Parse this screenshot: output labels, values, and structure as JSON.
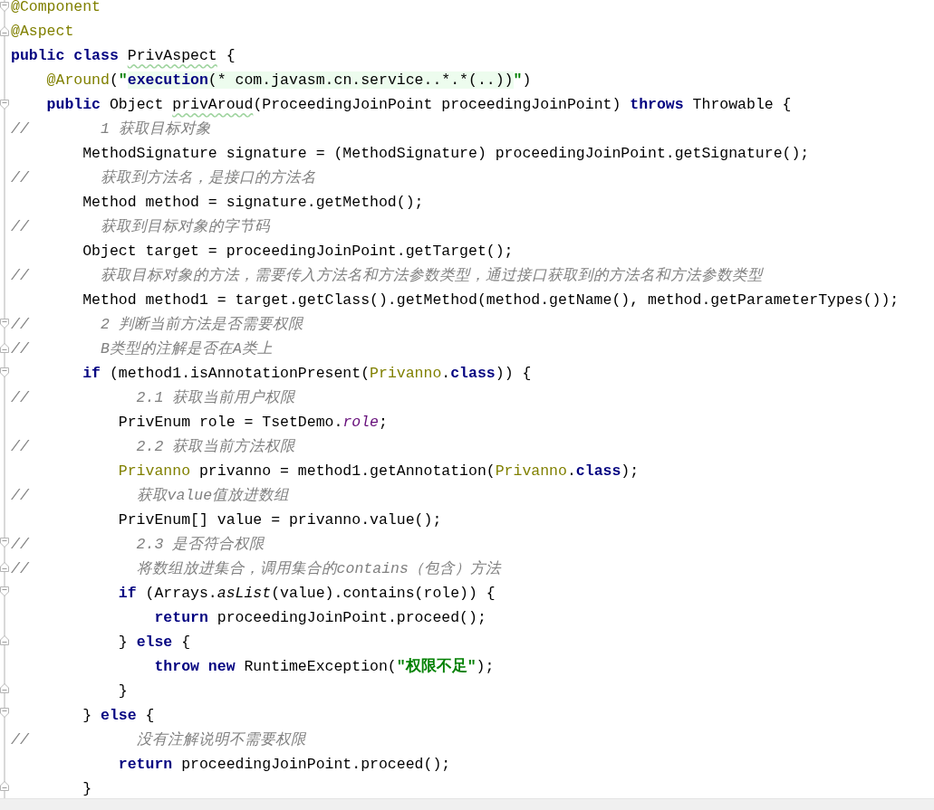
{
  "lines": [
    {
      "kind": "opener",
      "tokens": [
        {
          "kind": "ann",
          "text": "@Component"
        }
      ]
    },
    {
      "kind": "closer",
      "tokens": [
        {
          "kind": "ann",
          "text": "@Aspect"
        }
      ]
    },
    {
      "kind": "line",
      "tokens": [
        {
          "kind": "kw",
          "text": "public class "
        },
        {
          "kind": "warn",
          "text": "PrivAspect"
        },
        {
          "kind": "plain",
          "text": " {"
        }
      ]
    },
    {
      "kind": "line",
      "tokens": [
        {
          "kind": "ann",
          "text": "    @Around"
        },
        {
          "kind": "plain",
          "text": "("
        },
        {
          "kind": "str",
          "text": "\""
        },
        {
          "kind": "inj-kw",
          "text": "execution"
        },
        {
          "kind": "inj",
          "text": "(* com.javasm.cn.service..*.*(..))"
        },
        {
          "kind": "str",
          "text": "\""
        },
        {
          "kind": "plain",
          "text": ")"
        }
      ]
    },
    {
      "kind": "opener",
      "tokens": [
        {
          "kind": "kw",
          "text": "    public"
        },
        {
          "kind": "plain",
          "text": " Object "
        },
        {
          "kind": "warn",
          "text": "privAroud"
        },
        {
          "kind": "plain",
          "text": "(ProceedingJoinPoint proceedingJoinPoint) "
        },
        {
          "kind": "kw",
          "text": "throws"
        },
        {
          "kind": "plain",
          "text": " Throwable {"
        }
      ]
    },
    {
      "kind": "line",
      "tokens": [
        {
          "kind": "cmt",
          "text": "//        1 获取目标对象"
        }
      ]
    },
    {
      "kind": "line",
      "tokens": [
        {
          "kind": "plain",
          "text": "        MethodSignature signature = (MethodSignature) proceedingJoinPoint.getSignature();"
        }
      ]
    },
    {
      "kind": "line",
      "tokens": [
        {
          "kind": "cmt",
          "text": "//        获取到方法名，是接口的方法名"
        }
      ]
    },
    {
      "kind": "line",
      "tokens": [
        {
          "kind": "plain",
          "text": "        Method method = signature.getMethod();"
        }
      ]
    },
    {
      "kind": "line",
      "tokens": [
        {
          "kind": "cmt",
          "text": "//        获取到目标对象的字节码"
        }
      ]
    },
    {
      "kind": "line",
      "tokens": [
        {
          "kind": "plain",
          "text": "        Object target = proceedingJoinPoint.getTarget();"
        }
      ]
    },
    {
      "kind": "line",
      "tokens": [
        {
          "kind": "cmt",
          "text": "//        获取目标对象的方法，需要传入方法名和方法参数类型，通过接口获取到的方法名和方法参数类型"
        }
      ]
    },
    {
      "kind": "line",
      "tokens": [
        {
          "kind": "plain",
          "text": "        Method method1 = target.getClass().getMethod(method.getName(), method.getParameterTypes());"
        }
      ]
    },
    {
      "kind": "opener",
      "tokens": [
        {
          "kind": "cmt",
          "text": "//        2 判断当前方法是否需要权限"
        }
      ]
    },
    {
      "kind": "closer",
      "tokens": [
        {
          "kind": "cmt",
          "text": "//        B类型的注解是否在A类上"
        }
      ]
    },
    {
      "kind": "opener",
      "tokens": [
        {
          "kind": "kw",
          "text": "        if"
        },
        {
          "kind": "plain",
          "text": " (method1.isAnnotationPresent("
        },
        {
          "kind": "type",
          "text": "Privanno"
        },
        {
          "kind": "plain",
          "text": "."
        },
        {
          "kind": "kw",
          "text": "class"
        },
        {
          "kind": "plain",
          "text": ")) {"
        }
      ]
    },
    {
      "kind": "line",
      "tokens": [
        {
          "kind": "cmt",
          "text": "//            2.1 获取当前用户权限"
        }
      ]
    },
    {
      "kind": "line",
      "tokens": [
        {
          "kind": "plain",
          "text": "            PrivEnum role = TsetDemo."
        },
        {
          "kind": "field",
          "text": "role"
        },
        {
          "kind": "plain",
          "text": ";"
        }
      ]
    },
    {
      "kind": "line",
      "tokens": [
        {
          "kind": "cmt",
          "text": "//            2.2 获取当前方法权限"
        }
      ]
    },
    {
      "kind": "line",
      "tokens": [
        {
          "kind": "type",
          "text": "            Privanno"
        },
        {
          "kind": "plain",
          "text": " privanno = method1.getAnnotation("
        },
        {
          "kind": "type",
          "text": "Privanno"
        },
        {
          "kind": "plain",
          "text": "."
        },
        {
          "kind": "kw",
          "text": "class"
        },
        {
          "kind": "plain",
          "text": ");"
        }
      ]
    },
    {
      "kind": "line",
      "tokens": [
        {
          "kind": "cmt",
          "text": "//            获取value值放进数组"
        }
      ]
    },
    {
      "kind": "line",
      "tokens": [
        {
          "kind": "plain",
          "text": "            PrivEnum[] value = privanno.value();"
        }
      ]
    },
    {
      "kind": "opener",
      "tokens": [
        {
          "kind": "cmt",
          "text": "//            2.3 是否符合权限"
        }
      ]
    },
    {
      "kind": "closer",
      "tokens": [
        {
          "kind": "cmt",
          "text": "//            将数组放进集合，调用集合的contains（包含）方法"
        }
      ]
    },
    {
      "kind": "opener",
      "tokens": [
        {
          "kind": "kw",
          "text": "            if"
        },
        {
          "kind": "plain",
          "text": " (Arrays."
        },
        {
          "kind": "static",
          "text": "asList"
        },
        {
          "kind": "plain",
          "text": "(value).contains(role)) {"
        }
      ]
    },
    {
      "kind": "line",
      "tokens": [
        {
          "kind": "kw",
          "text": "                return"
        },
        {
          "kind": "plain",
          "text": " proceedingJoinPoint.proceed();"
        }
      ]
    },
    {
      "kind": "closer",
      "tokens": [
        {
          "kind": "plain",
          "text": "            } "
        },
        {
          "kind": "kw",
          "text": "else"
        },
        {
          "kind": "plain",
          "text": " {"
        }
      ]
    },
    {
      "kind": "line",
      "tokens": [
        {
          "kind": "kw",
          "text": "                throw new"
        },
        {
          "kind": "plain",
          "text": " RuntimeException("
        },
        {
          "kind": "str",
          "text": "\"权限不足\""
        },
        {
          "kind": "plain",
          "text": ");"
        }
      ]
    },
    {
      "kind": "closer",
      "tokens": [
        {
          "kind": "plain",
          "text": "            }"
        }
      ]
    },
    {
      "kind": "opener",
      "tokens": [
        {
          "kind": "plain",
          "text": "        } "
        },
        {
          "kind": "kw",
          "text": "else"
        },
        {
          "kind": "plain",
          "text": " {"
        }
      ]
    },
    {
      "kind": "line",
      "tokens": [
        {
          "kind": "cmt",
          "text": "//            没有注解说明不需要权限"
        }
      ]
    },
    {
      "kind": "line",
      "tokens": [
        {
          "kind": "kw",
          "text": "            return"
        },
        {
          "kind": "plain",
          "text": " proceedingJoinPoint.proceed();"
        }
      ]
    },
    {
      "kind": "closer",
      "tokens": [
        {
          "kind": "plain",
          "text": "        }"
        }
      ]
    }
  ]
}
